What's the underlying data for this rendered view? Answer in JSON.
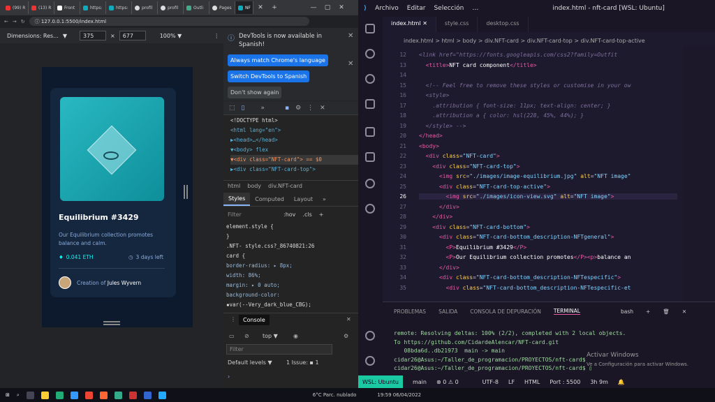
{
  "browser": {
    "tabs": [
      "(99) R",
      "(13) R",
      "Front",
      "https:",
      "https:",
      "profil",
      "profil",
      "Outli",
      "Pages",
      "NF"
    ],
    "url": "127.0.0.1:5500/index.html"
  },
  "device_toolbar": {
    "dimensions_label": "Dimensions: Res...",
    "width": "375",
    "times": "×",
    "height": "677",
    "zoom": "100% ▼"
  },
  "nft": {
    "title": "Equilibrium #3429",
    "description": "Our Equilibrium collection promotes balance and calm.",
    "price": "0.041 ETH",
    "days": "3 days left",
    "creator_prefix": "Creation of",
    "creator_name": "Jules Wyvern"
  },
  "devtools": {
    "notice": "DevTools is now available in Spanish!",
    "btn_match": "Always match Chrome's language",
    "btn_switch": "Switch DevTools to Spanish",
    "btn_dont": "Don't show again",
    "elements": [
      "<!DOCTYPE html>",
      "<html lang=\"en\">",
      "▶<head>…</head>",
      "▼<body> flex",
      "▼<div class=\"NFT-card\"> == $0",
      "▶<div class=\"NFT-card-top\">"
    ],
    "breadcrumb": [
      "html",
      "body",
      "div.NFT-card"
    ],
    "style_tabs": [
      "Styles",
      "Computed",
      "Layout",
      "»"
    ],
    "filter_placeholder": "Filter",
    "hov": ":hov",
    "cls": ".cls",
    "styles": [
      "element.style {",
      "}",
      ".NFT-        style.css?_86740821:26",
      "card {",
      "  border-radius: ▸ 8px;",
      "  width: 86%;",
      "  margin: ▸ 0 auto;",
      "  background-color:",
      "    ▪var(--Very_dark_blue_CBG);",
      "  box-shadow:"
    ],
    "console_tab": "Console",
    "console_level": "top ▼",
    "console_filter": "Filter",
    "default_levels": "Default levels ▼",
    "issues": "1 Issue: ▪ 1"
  },
  "vscode": {
    "menu": [
      "Archivo",
      "Editar",
      "Selección",
      "…"
    ],
    "title": "index.html - nft-card [WSL: Ubuntu]",
    "tabs": [
      "index.html",
      "style.css",
      "desktop.css"
    ],
    "breadcrumb": "index.html > html > body > div.NFT-card > div.NFT-card-top > div.NFT-card-top-active",
    "lines": [
      {
        "n": "12",
        "html": "<span class='c'>&lt;link href=\"https://fonts.googleapis.com/css2?family=Outfit</span>"
      },
      {
        "n": "13",
        "html": "  <span class='t'>&lt;title&gt;</span><span class='x'>NFT card component</span><span class='t'>&lt;/title&gt;</span>"
      },
      {
        "n": "14",
        "html": ""
      },
      {
        "n": "15",
        "html": "  <span class='c'>&lt;!-- Feel free to remove these styles or customise in your ow</span>"
      },
      {
        "n": "16",
        "html": "  <span class='c'>&lt;style&gt;</span>"
      },
      {
        "n": "17",
        "html": "  <span class='c'>  .attribution { font-size: 11px; text-align: center; }</span>"
      },
      {
        "n": "18",
        "html": "  <span class='c'>  .attribution a { color: hsl(228, 45%, 44%); }</span>"
      },
      {
        "n": "19",
        "html": "  <span class='c'>&lt;/style&gt; --&gt;</span>"
      },
      {
        "n": "20",
        "html": "<span class='t'>&lt;/head&gt;</span>"
      },
      {
        "n": "21",
        "html": "<span class='t'>&lt;body&gt;</span>"
      },
      {
        "n": "22",
        "html": "  <span class='t'>&lt;div</span> <span class='a'>class</span>=<span class='s'>\"NFT-card\"</span><span class='t'>&gt;</span>"
      },
      {
        "n": "23",
        "html": "    <span class='t'>&lt;div</span> <span class='a'>class</span>=<span class='s'>\"NFT-card-top\"</span><span class='t'>&gt;</span>"
      },
      {
        "n": "24",
        "html": "      <span class='t'>&lt;img</span> <span class='a'>src</span>=<span class='s'>\"./images/image-equilibrium.jpg\"</span> <span class='a'>alt</span>=<span class='s'>\"NFT image\"</span>"
      },
      {
        "n": "25",
        "html": "      <span class='t'>&lt;div</span> <span class='a'>class</span>=<span class='s'>\"NFT-card-top-active\"</span><span class='t'>&gt;</span>"
      },
      {
        "n": "26",
        "html": "        <span class='t'>&lt;img</span> <span class='a'>src</span>=<span class='s'>\"./images/icon-view.svg\"</span> <span class='a'>alt</span>=<span class='s'>\"NFT image\"</span><span class='t'>&gt;</span>"
      },
      {
        "n": "27",
        "html": "      <span class='t'>&lt;/div&gt;</span>"
      },
      {
        "n": "28",
        "html": "    <span class='t'>&lt;/div&gt;</span>"
      },
      {
        "n": "29",
        "html": "    <span class='t'>&lt;div</span> <span class='a'>class</span>=<span class='s'>\"NFT-card-bottom\"</span><span class='t'>&gt;</span>"
      },
      {
        "n": "30",
        "html": "      <span class='t'>&lt;div</span> <span class='a'>class</span>=<span class='s'>\"NFT-card-bottom_description-NFTgeneral\"</span><span class='t'>&gt;</span>"
      },
      {
        "n": "31",
        "html": "        <span class='t'>&lt;P&gt;</span><span class='x'>Equilibrium #3429</span><span class='t'>&lt;/P&gt;</span>"
      },
      {
        "n": "32",
        "html": "        <span class='t'>&lt;P&gt;</span><span class='x'>Our Equilibrium collection promotes</span><span class='t'>&lt;/P&gt;&lt;p&gt;</span><span class='x'>balance an</span>"
      },
      {
        "n": "33",
        "html": "      <span class='t'>&lt;/div&gt;</span>"
      },
      {
        "n": "34",
        "html": "      <span class='t'>&lt;div</span> <span class='a'>class</span>=<span class='s'>\"NFT-card-bottom_description-NFTespecific\"</span><span class='t'>&gt;</span>"
      },
      {
        "n": "35",
        "html": "        <span class='t'>&lt;div</span> <span class='a'>class</span>=<span class='s'>\"NFT-card-bottom_description-NFTespecific-et</span>"
      }
    ],
    "panel_tabs": [
      "PROBLEMAS",
      "SALIDA",
      "CONSOLA DE DEPURACIÓN",
      "TERMINAL"
    ],
    "terminal_shell": "bash",
    "terminal": "remote: Resolving deltas: 100% (2/2), completed with 2 local objects.\nTo https://github.com/CidardeAlencar/NFT-card.git\n   08bda6d..db21973  main -> main\ncidar26@Asus:~/Taller_de_programacion/PROYECTOS/nft-card$\ncidar26@Asus:~/Taller_de_programacion/PROYECTOS/nft-card$ ▯",
    "status": [
      "WSL: Ubuntu",
      "main",
      "⊗ 0 ⚠ 0",
      "UTF-8",
      "LF",
      "HTML",
      "Port : 5500",
      "3h 9m"
    ],
    "activate_title": "Activar Windows",
    "activate_sub": "Ve a Configuración para activar Windows."
  },
  "taskbar": {
    "weather": "6°C Parc. nublado",
    "time": "19:59",
    "date": "06/04/2022"
  }
}
